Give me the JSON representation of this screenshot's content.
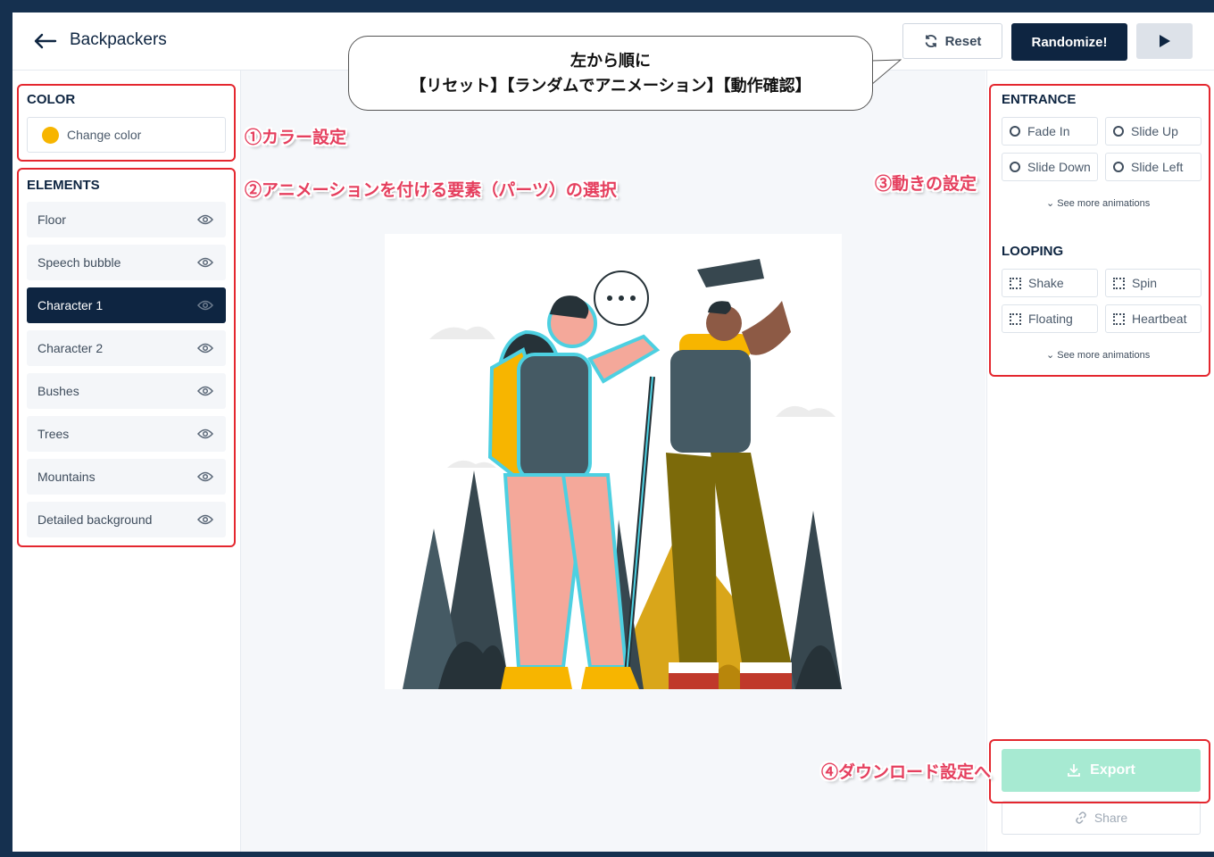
{
  "header": {
    "title": "Backpackers",
    "reset_label": "Reset",
    "randomize_label": "Randomize!"
  },
  "left": {
    "color_title": "COLOR",
    "change_color_label": "Change color",
    "color_swatch": "#f7b500",
    "elements_title": "ELEMENTS",
    "elements": [
      {
        "label": "Floor",
        "selected": false
      },
      {
        "label": "Speech bubble",
        "selected": false
      },
      {
        "label": "Character 1",
        "selected": true
      },
      {
        "label": "Character 2",
        "selected": false
      },
      {
        "label": "Bushes",
        "selected": false
      },
      {
        "label": "Trees",
        "selected": false
      },
      {
        "label": "Mountains",
        "selected": false
      },
      {
        "label": "Detailed background",
        "selected": false
      }
    ]
  },
  "right": {
    "entrance_title": "ENTRANCE",
    "entrance": [
      "Fade In",
      "Slide Up",
      "Slide Down",
      "Slide Left"
    ],
    "see_more_1": "See more animations",
    "looping_title": "LOOPING",
    "looping": [
      "Shake",
      "Spin",
      "Floating",
      "Heartbeat"
    ],
    "see_more_2": "See more animations",
    "export_label": "Export",
    "share_label": "Share"
  },
  "annotations": {
    "bubble_line1": "左から順に",
    "bubble_line2": "【リセット】【ランダムでアニメーション】【動作確認】",
    "color_note": "①カラー設定",
    "elements_note": "②アニメーションを付ける要素（パーツ）の選択",
    "motion_note": "③動きの設定",
    "export_note": "④ダウンロード設定へ"
  },
  "colors": {
    "navy": "#0e2541",
    "export_green": "#a7ead2",
    "annotation_red": "#e4272f"
  }
}
